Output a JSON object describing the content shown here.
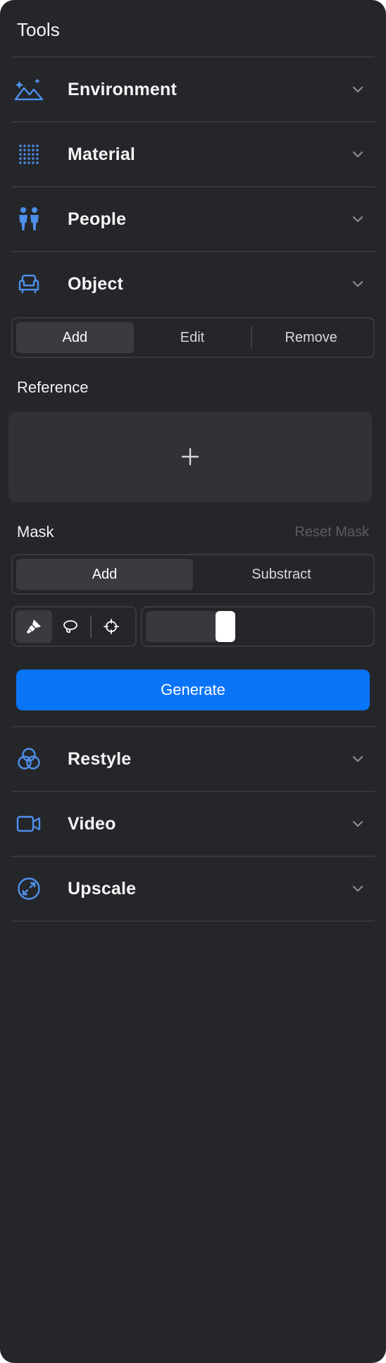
{
  "panel": {
    "title": "Tools"
  },
  "colors": {
    "accent": "#0a74f7",
    "icon": "#4d90ea",
    "background": "#25262a"
  },
  "sections_top": [
    {
      "label": "Environment",
      "icon": "mountains-icon"
    },
    {
      "label": "Material",
      "icon": "dot-grid-icon"
    },
    {
      "label": "People",
      "icon": "people-icon"
    },
    {
      "label": "Object",
      "icon": "armchair-icon"
    }
  ],
  "object_panel": {
    "modes": [
      {
        "label": "Add",
        "active": true
      },
      {
        "label": "Edit",
        "active": false
      },
      {
        "label": "Remove",
        "active": false
      }
    ],
    "reference_label": "Reference",
    "reference_dropzone_icon": "plus-icon",
    "mask_label": "Mask",
    "reset_mask_label": "Reset Mask",
    "mask_modes": [
      {
        "label": "Add",
        "active": true
      },
      {
        "label": "Substract",
        "active": false
      }
    ],
    "mask_tools": [
      {
        "icon": "brush-icon",
        "active": true
      },
      {
        "icon": "lasso-icon",
        "active": false
      },
      {
        "icon": "crosshair-icon",
        "active": false
      }
    ],
    "brush_size_fraction": 0.34,
    "generate_label": "Generate"
  },
  "sections_bottom": [
    {
      "label": "Restyle",
      "icon": "color-circles-icon"
    },
    {
      "label": "Video",
      "icon": "video-camera-icon"
    },
    {
      "label": "Upscale",
      "icon": "expand-icon"
    }
  ]
}
